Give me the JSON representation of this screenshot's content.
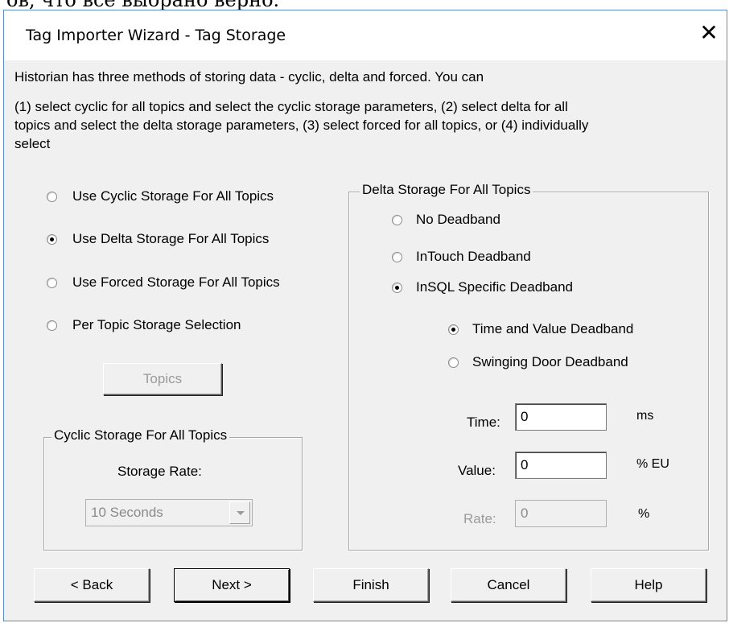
{
  "top_fragment": "ов, что все выбрано верно.",
  "window": {
    "title": "Tag Importer Wizard - Tag Storage",
    "close_glyph": "✕"
  },
  "intro": {
    "line1": "Historian has three methods of storing data - cyclic, delta and forced. You can",
    "line2": "(1) select cyclic for all topics and select the cyclic storage parameters, (2) select delta for all",
    "line3": "topics and select the delta storage parameters, (3) select forced for all topics, or (4) individually",
    "line4": "select"
  },
  "storage_mode": {
    "options": [
      {
        "label": "Use Cyclic Storage For All Topics",
        "selected": false
      },
      {
        "label": "Use Delta Storage For All Topics",
        "selected": true
      },
      {
        "label": "Use Forced Storage For All Topics",
        "selected": false
      },
      {
        "label": "Per Topic Storage Selection",
        "selected": false
      }
    ],
    "topics_button": "Topics"
  },
  "cyclic_group": {
    "title": "Cyclic Storage For All Topics",
    "storage_rate_label": "Storage Rate:",
    "storage_rate_value": "10 Seconds"
  },
  "delta_group": {
    "title": "Delta Storage For All Topics",
    "options": [
      {
        "label": "No Deadband",
        "selected": false
      },
      {
        "label": "InTouch Deadband",
        "selected": false
      },
      {
        "label": "InSQL Specific Deadband",
        "selected": true
      }
    ],
    "sub_options": [
      {
        "label": "Time and Value Deadband",
        "selected": true
      },
      {
        "label": "Swinging Door Deadband",
        "selected": false
      }
    ],
    "fields": {
      "time_label": "Time:",
      "time_value": "0",
      "time_unit": "ms",
      "value_label": "Value:",
      "value_value": "0",
      "value_unit": "% EU",
      "rate_label": "Rate:",
      "rate_value": "0",
      "rate_unit": "%"
    }
  },
  "footer": {
    "back": "< Back",
    "next": "Next >",
    "finish": "Finish",
    "cancel": "Cancel",
    "help": "Help"
  }
}
